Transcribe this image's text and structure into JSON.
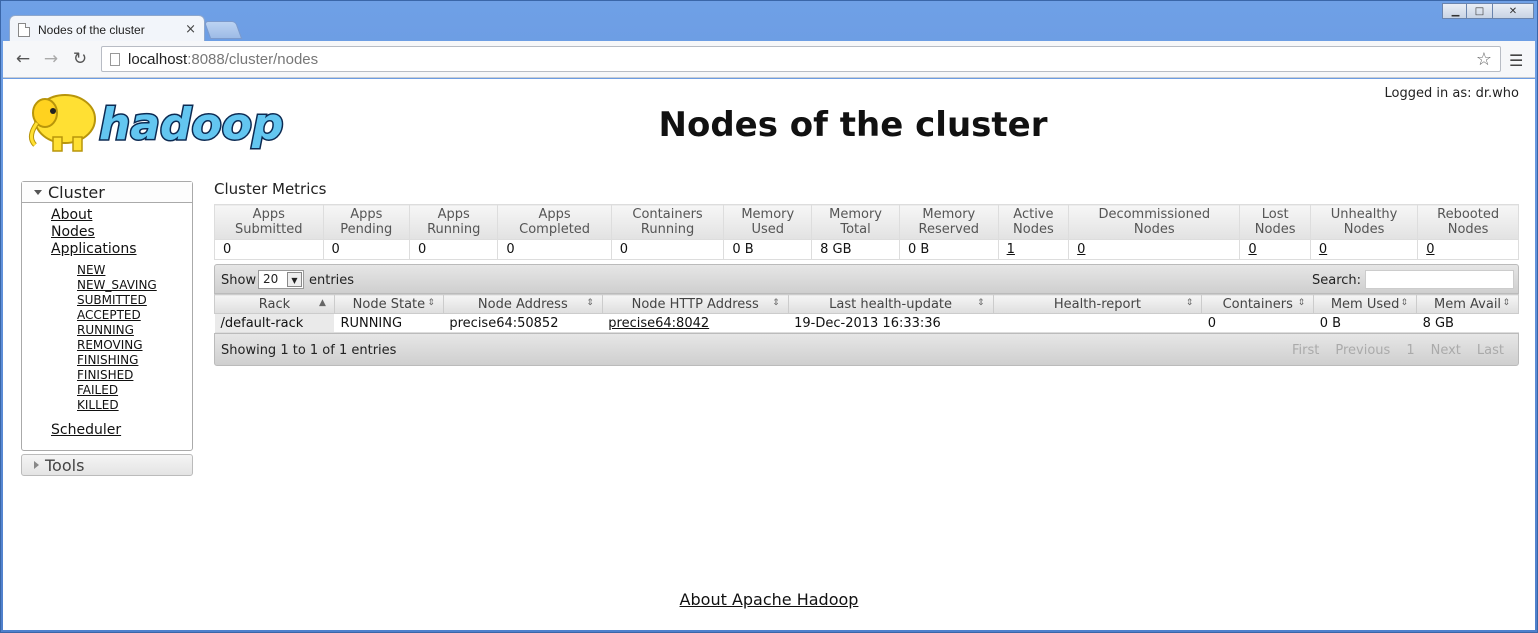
{
  "browser": {
    "tab_title": "Nodes of the cluster",
    "tab_close": "×",
    "url_host": "localhost",
    "url_path": ":8088/cluster/nodes",
    "back_glyph": "←",
    "forward_glyph": "→",
    "reload_glyph": "↻",
    "star_glyph": "☆",
    "menu_glyph": "☰",
    "min_glyph": "▁",
    "max_glyph": "□",
    "close_glyph": "✕"
  },
  "header": {
    "logo_text": "hadoop",
    "title": "Nodes of the cluster",
    "logged_in": "Logged in as: dr.who"
  },
  "sidebar": {
    "cluster_label": "Cluster",
    "links": {
      "about": "About",
      "nodes": "Nodes",
      "applications": "Applications",
      "scheduler": "Scheduler"
    },
    "app_states": [
      "NEW",
      "NEW_SAVING",
      "SUBMITTED",
      "ACCEPTED",
      "RUNNING",
      "REMOVING",
      "FINISHING",
      "FINISHED",
      "FAILED",
      "KILLED"
    ],
    "tools_label": "Tools"
  },
  "metrics": {
    "title": "Cluster Metrics",
    "headers": [
      [
        "Apps",
        "Submitted"
      ],
      [
        "Apps",
        "Pending"
      ],
      [
        "Apps",
        "Running"
      ],
      [
        "Apps",
        "Completed"
      ],
      [
        "Containers",
        "Running"
      ],
      [
        "Memory",
        "Used"
      ],
      [
        "Memory",
        "Total"
      ],
      [
        "Memory",
        "Reserved"
      ],
      [
        "Active",
        "Nodes"
      ],
      [
        "Decommissioned",
        "Nodes"
      ],
      [
        "Lost",
        "Nodes"
      ],
      [
        "Unhealthy",
        "Nodes"
      ],
      [
        "Rebooted",
        "Nodes"
      ]
    ],
    "values": [
      "0",
      "0",
      "0",
      "0",
      "0",
      "0 B",
      "8 GB",
      "0 B",
      "1",
      "0",
      "0",
      "0",
      "0"
    ]
  },
  "nodes_table": {
    "show_label": "Show",
    "length_value": "20",
    "entries_label": "entries",
    "search_label": "Search:",
    "columns": [
      "Rack",
      "Node State",
      "Node Address",
      "Node HTTP Address",
      "Last health-update",
      "Health-report",
      "Containers",
      "Mem Used",
      "Mem Avail"
    ],
    "rows": [
      [
        "/default-rack",
        "RUNNING",
        "precise64:50852",
        "precise64:8042",
        "19-Dec-2013 16:33:36",
        "",
        "0",
        "0 B",
        "8 GB"
      ]
    ],
    "showing": "Showing 1 to 1 of 1 entries",
    "pager": [
      "First",
      "Previous",
      "1",
      "Next",
      "Last"
    ]
  },
  "footer": {
    "link": "About Apache Hadoop"
  }
}
